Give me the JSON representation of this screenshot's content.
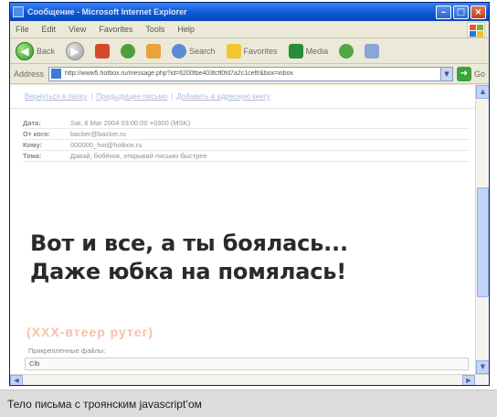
{
  "window": {
    "title": "Сообщение - Microsoft Internet Explorer",
    "minimize": "–",
    "maximize": "□",
    "close": "×"
  },
  "menu": [
    "File",
    "Edit",
    "View",
    "Favorites",
    "Tools",
    "Help"
  ],
  "toolbar": {
    "back": "Back",
    "search": "Search",
    "favorites": "Favorites",
    "media": "Media"
  },
  "address": {
    "label": "Address",
    "url": "http://www5.hotbox.ru/message.php?id=6200fbe403fcff0fd7a2c1ceff/&box=inbox",
    "go": "Go"
  },
  "message": {
    "links": [
      "Вернуться в папку",
      "Предыдущее письмо",
      "Добавить в адресную книгу"
    ],
    "headers": [
      {
        "key": "Дата:",
        "value": "Sat, 6 Mar 2004 03:00:00 +0300 (MSK)"
      },
      {
        "key": "От кого:",
        "value": "backer@backer.ru"
      },
      {
        "key": "Кому:",
        "value": "000000_hot@hotbox.ru"
      },
      {
        "key": "Тема:",
        "value": "Давай, бобёнок, открывай письмо быстрее"
      }
    ],
    "body_line_1": "Вот и все, а ты боялась...",
    "body_line_2": "Даже юбка на помялась!",
    "orange_text": "(ХХХ-втеер рутег)",
    "attachments_label": "Прикрепленные файлы:",
    "attachment": "Clb"
  },
  "caption": "Тело письма с троянским javascript’ом"
}
